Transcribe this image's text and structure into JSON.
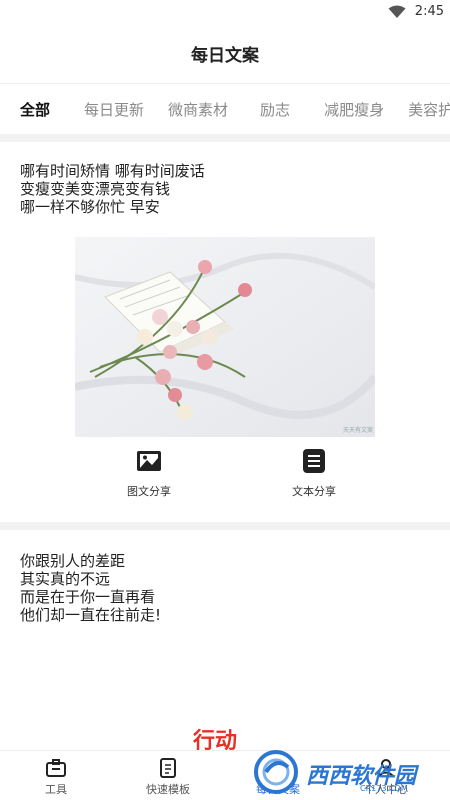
{
  "status_bar": {
    "time": "2:45",
    "wifi_icon": "wifi-icon"
  },
  "header": {
    "title": "每日文案"
  },
  "tabs": [
    {
      "label": "全部",
      "active": true
    },
    {
      "label": "每日更新",
      "active": false
    },
    {
      "label": "微商素材",
      "active": false
    },
    {
      "label": "励志",
      "active": false
    },
    {
      "label": "减肥瘦身",
      "active": false
    },
    {
      "label": "美容护",
      "active": false
    }
  ],
  "posts": [
    {
      "text": "哪有时间矫情 哪有时间废话\n变瘦变美变漂亮变有钱\n哪一样不够你忙 早安",
      "image_icon": "flowers-on-book-photo",
      "image_watermark": "天天有文案",
      "share_image_label": "图文分享",
      "share_text_label": "文本分享"
    },
    {
      "text": "     你跟别人的差距\n其实真的不远\n而是在于你一直再看\n他们却一直在往前走!",
      "poster_text": "行动"
    }
  ],
  "bottom_nav": [
    {
      "label": "工具",
      "icon": "toolbox-icon",
      "active": false
    },
    {
      "label": "快速模板",
      "icon": "template-icon",
      "active": false
    },
    {
      "label": "每日文案",
      "icon": "document-icon",
      "active": true
    },
    {
      "label": "个人中心",
      "icon": "person-icon",
      "active": false
    }
  ],
  "overlay_logo": {
    "text": "西西软件园",
    "sub": "CR173.COM"
  },
  "colors": {
    "accent": "#2d6fe0",
    "poster_red": "#e53023",
    "divider": "#f2f2f2"
  }
}
